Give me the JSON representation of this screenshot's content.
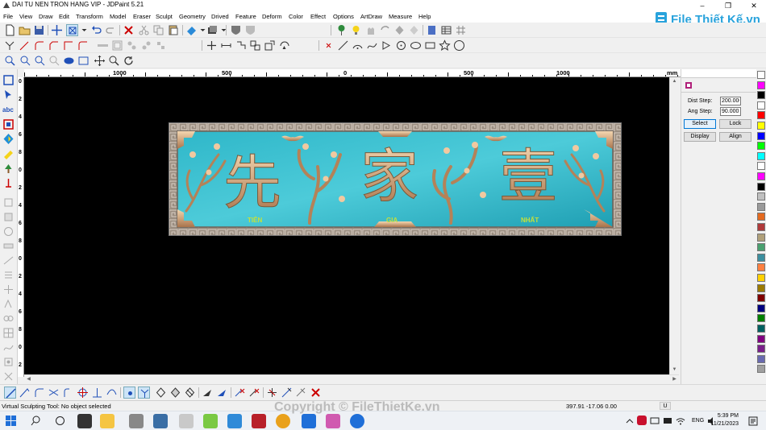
{
  "window": {
    "title": "DAI TU NEN TRON HANG VIP - JDPaint 5.21",
    "controls": [
      "–",
      "❐",
      "✕"
    ]
  },
  "menubar": {
    "items": [
      "File",
      "View",
      "Draw",
      "Edit",
      "Transform",
      "Model",
      "Eraser",
      "Sculpt",
      "Geometry",
      "Drived",
      "Feature",
      "Deform",
      "Color",
      "Effect",
      "Options",
      "ArtDraw",
      "Measure",
      "Help"
    ]
  },
  "watermark": {
    "logo_text": "File Thiết Kế.vn",
    "copyright": "Copyright © FileThietKe.vn"
  },
  "ruler": {
    "h_labels": [
      "1000",
      "500",
      "0",
      "500",
      "1000"
    ],
    "unit": "mm",
    "v_labels": [
      "0",
      "2",
      "4",
      "6",
      "8",
      "0",
      "2",
      "4",
      "6",
      "8",
      "0",
      "2",
      "4",
      "6",
      "8",
      "0",
      "2"
    ]
  },
  "relief": {
    "main_characters": [
      "先",
      "家",
      "壹"
    ],
    "small_labels": [
      "TIÊN",
      "GIA",
      "NHẤT"
    ]
  },
  "side_panel": {
    "dist_step_label": "Dist Step:",
    "dist_step_value": "200.000",
    "ang_step_label": "Ang Step:",
    "ang_step_value": "90.000",
    "buttons": {
      "select": "Select",
      "lock": "Lock",
      "display": "Display",
      "align": "Align"
    }
  },
  "palette": {
    "colors": [
      "#ffffff",
      "#ff00ff",
      "#000000",
      "#ffffff",
      "#ff0000",
      "#ffff00",
      "#0000ff",
      "#00ff00",
      "#00ffff",
      "#ffffff",
      "#ff00ff",
      "#000000",
      "#c0c0c0",
      "#9a9a9a",
      "#e46a1f",
      "#b03a3a",
      "#b0a07a",
      "#4aa070",
      "#3c8f9f",
      "#ff8040",
      "#ffd000",
      "#9c7a00",
      "#800000",
      "#000080",
      "#008000",
      "#006060",
      "#800080",
      "#7a1f8a",
      "#6a6ab0",
      "#a0a0a0"
    ]
  },
  "status": {
    "message": "Virtual Sculpting Tool: No object selected",
    "coords": "397.91 -17.06 0.00",
    "unit": "U"
  },
  "taskbar": {
    "language": "ENG",
    "time": "5:39 PM",
    "date": "11/21/2023"
  }
}
